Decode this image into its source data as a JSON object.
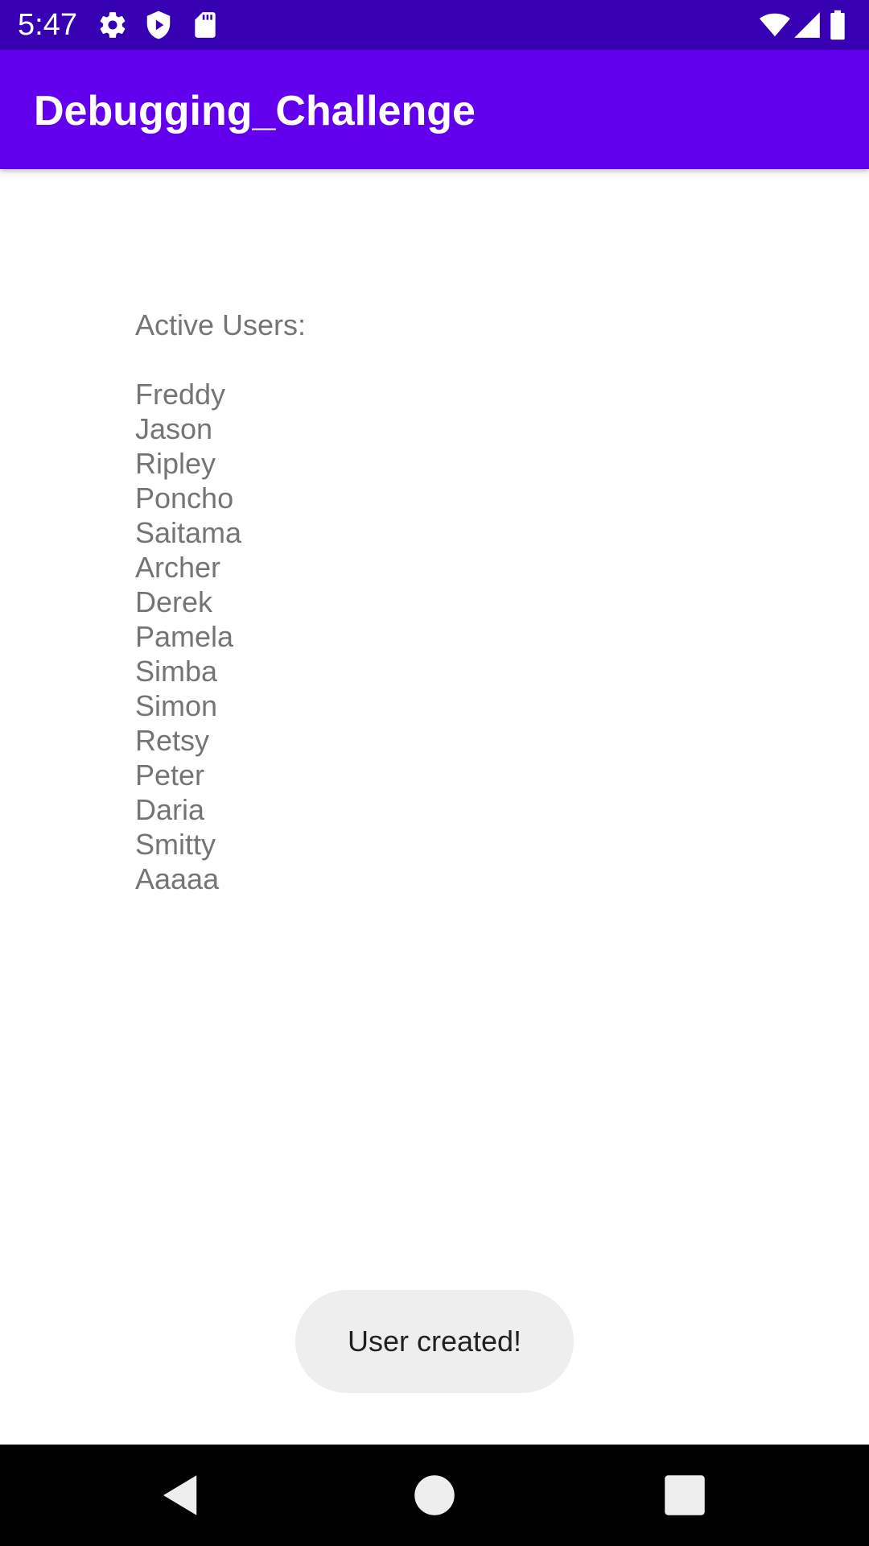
{
  "status_bar": {
    "time": "5:47",
    "icons": [
      "gear-icon",
      "shield-play-icon",
      "sd-card-icon",
      "wifi-icon",
      "signal-icon",
      "battery-icon"
    ],
    "background": "#3700b3"
  },
  "app_bar": {
    "title": "Debugging_Challenge",
    "background": "#6200ee"
  },
  "content": {
    "heading": "Active Users:",
    "users": [
      "Freddy",
      "Jason",
      "Ripley",
      "Poncho",
      "Saitama",
      "Archer",
      "Derek",
      "Pamela",
      "Simba",
      "Simon",
      "Retsy",
      "Peter",
      "Daria",
      "Smitty",
      "Aaaaa"
    ],
    "text_color": "#757575"
  },
  "toast": {
    "message": "User created!"
  },
  "nav_bar": {
    "buttons": [
      "back-icon",
      "home-icon",
      "recents-icon"
    ]
  }
}
